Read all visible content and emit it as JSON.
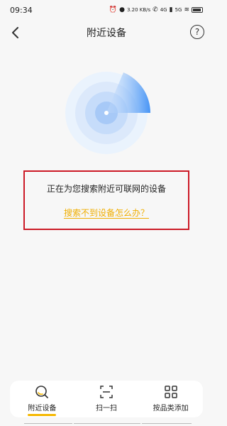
{
  "status_bar": {
    "time": "09:34",
    "speed": "3.20 KB/s",
    "net1": "4G",
    "net2": "5G"
  },
  "nav": {
    "title": "附近设备",
    "help_symbol": "?"
  },
  "main": {
    "searching_text": "正在为您搜索附近可联网的设备",
    "help_link": "搜索不到设备怎么办？"
  },
  "tabs": [
    {
      "label": "附近设备",
      "icon": "search-device-icon",
      "active": true
    },
    {
      "label": "扫一扫",
      "icon": "scan-icon",
      "active": false
    },
    {
      "label": "按品类添加",
      "icon": "grid-icon",
      "active": false
    }
  ],
  "colors": {
    "accent": "#f5b800",
    "link": "#f0ae00",
    "highlight_frame": "#cc1a26",
    "radar": "#3d8ff5"
  }
}
